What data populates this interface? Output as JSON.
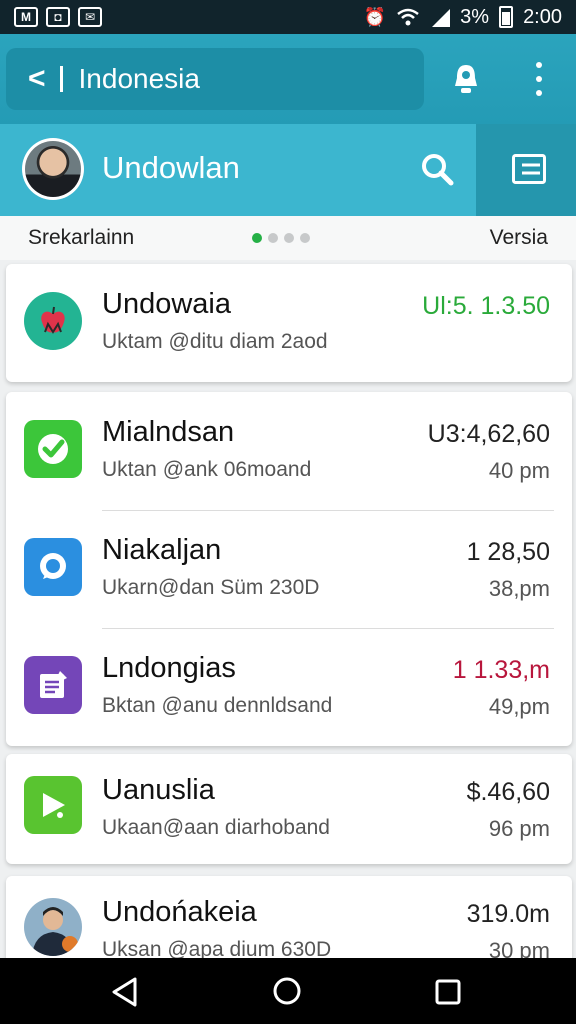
{
  "status_bar": {
    "left_icons": [
      "M",
      "◘",
      "✉"
    ],
    "battery_text": "3%",
    "time": "2:00"
  },
  "app_bar": {
    "title": "Indonesia",
    "back_glyph": "<"
  },
  "profile": {
    "name": "Undowlan"
  },
  "subheader": {
    "left_label": "Srekarlainn",
    "right_label": "Versia",
    "page_dots": 4,
    "active_dot": 0
  },
  "cards": [
    {
      "rows": [
        {
          "title": "Undowaia",
          "subtitle": "Uktam @ditu diam 2aod",
          "amount": "Ul:5. 1.3.50",
          "time": "",
          "amount_color": "#2aaa3a",
          "icon": "apple-icon",
          "icon_bg": "#23b493"
        }
      ]
    },
    {
      "rows": [
        {
          "title": "Mialndsan",
          "subtitle": "Uktan @ank 06moand",
          "amount": "U3:4,62,60",
          "time": "40 pm",
          "amount_color": "#222222",
          "icon": "check-icon",
          "icon_bg": "#3cc63a"
        },
        {
          "title": "Niakaljan",
          "subtitle": "Ukarn@dan Süm 230D",
          "amount": "1 28,50",
          "time": "38,pm",
          "amount_color": "#222222",
          "icon": "chat-icon",
          "icon_bg": "#2b8fe0"
        },
        {
          "title": "Lndongias",
          "subtitle": "Bktan @anu dennldsand",
          "amount": "1 1.33,m",
          "time": "49,pm",
          "amount_color": "#b8163c",
          "icon": "note-icon",
          "icon_bg": "#7446b8"
        }
      ]
    },
    {
      "rows": [
        {
          "title": "Uanuslia",
          "subtitle": "Ukaan@aan diarhoband",
          "amount": "$.46,60",
          "time": "96 pm",
          "amount_color": "#222222",
          "icon": "play-icon",
          "icon_bg": "#59c430"
        }
      ]
    },
    {
      "rows": [
        {
          "title": "Undońakeia",
          "subtitle": "Uksan @apa dium 630D",
          "amount": "319.0m",
          "time": "30 pm",
          "amount_color": "#222222",
          "icon": "person-avatar-icon",
          "icon_bg": "#8fb0c8"
        }
      ]
    }
  ],
  "colors": {
    "header_teal": "#2ba4bd",
    "profile_teal": "#3cb6cf",
    "accent_green": "#25b046"
  }
}
